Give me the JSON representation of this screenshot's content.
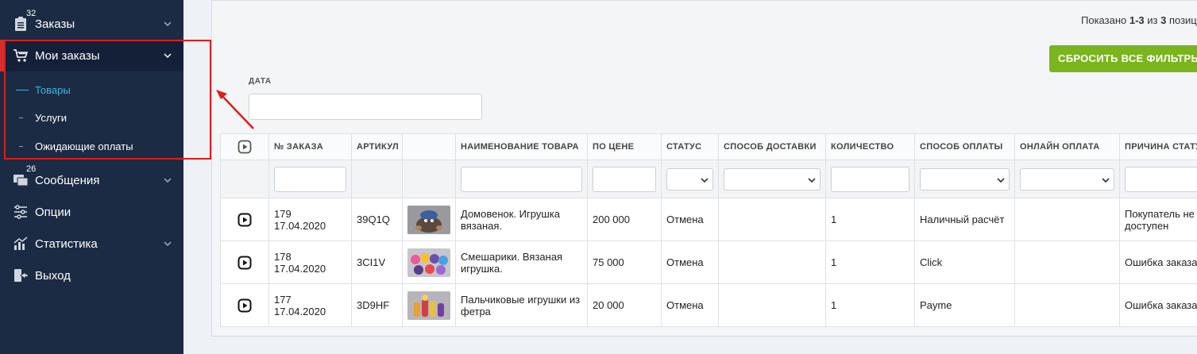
{
  "sidebar": {
    "items": [
      {
        "label": "Заказы",
        "badge": "32",
        "icon": "orders-icon"
      },
      {
        "label": "Мои заказы",
        "icon": "cart-icon"
      },
      {
        "label": "Сообщения",
        "badge": "26",
        "icon": "messages-icon"
      },
      {
        "label": "Опции",
        "icon": "options-icon"
      },
      {
        "label": "Статистика",
        "icon": "stats-icon"
      },
      {
        "label": "Выход",
        "icon": "exit-icon"
      }
    ],
    "submenu": [
      {
        "label": "Товары"
      },
      {
        "label": "Услуги"
      },
      {
        "label": "Ожидающие оплаты"
      }
    ]
  },
  "main": {
    "shown_prefix": "Показано ",
    "shown_range": "1-3",
    "shown_mid": " из ",
    "shown_total": "3",
    "shown_suffix": " позиц",
    "reset_button": "СБРОСИТЬ ВСЕ ФИЛЬТРЫ",
    "date_label": "ДАТА"
  },
  "table": {
    "headers": [
      "№ ЗАКАЗА",
      "АРТИКУЛ",
      "",
      "НАИМЕНОВАНИЕ ТОВАРА",
      "ПО ЦЕНЕ",
      "СТАТУС",
      "СПОСОБ ДОСТАВКИ",
      "КОЛИЧЕСТВО",
      "СПОСОБ ОПЛАТЫ",
      "ОНЛАЙН ОПЛАТА",
      "ПРИЧИНА СТАТУСА"
    ],
    "rows": [
      {
        "order": "179",
        "date": "17.04.2020",
        "sku": "39Q1Q",
        "name1": "Домовенок. Игрушка",
        "name2": "вязаная.",
        "price": "200 000",
        "status": "Отмена",
        "delivery": "",
        "qty": "1",
        "payment": "Наличный расчёт",
        "online": "",
        "reason1": "Покупатель не",
        "reason2": "доступен"
      },
      {
        "order": "178",
        "date": "17.04.2020",
        "sku": "3CI1V",
        "name1": "Смешарики. Вязаная",
        "name2": "игрушка.",
        "price": "75 000",
        "status": "Отмена",
        "delivery": "",
        "qty": "1",
        "payment": "Click",
        "online": "",
        "reason1": "Ошибка заказа",
        "reason2": ""
      },
      {
        "order": "177",
        "date": "17.04.2020",
        "sku": "3D9HF",
        "name1": "Пальчиковые игрушки из",
        "name2": "фетра",
        "price": "20 000",
        "status": "Отмена",
        "delivery": "",
        "qty": "1",
        "payment": "Payme",
        "online": "",
        "reason1": "Ошибка заказа",
        "reason2": ""
      }
    ]
  },
  "colors": {
    "sidebar_bg": "#1b2b43",
    "accent": "#3fb4e8",
    "reset_btn": "#7ab51d",
    "highlight": "#e01b1b"
  }
}
